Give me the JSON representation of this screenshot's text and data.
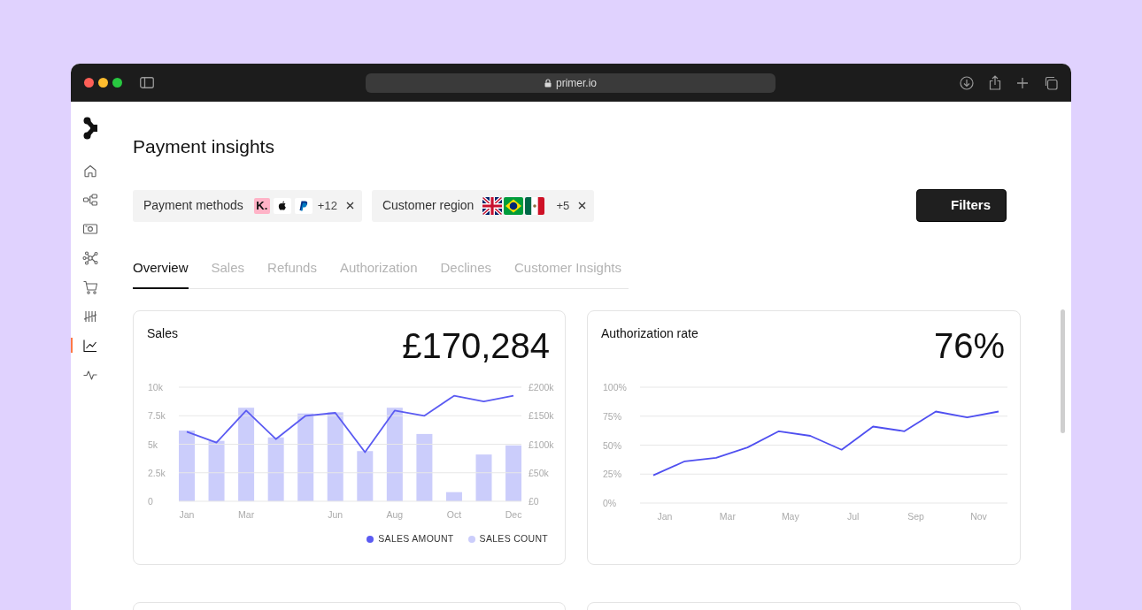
{
  "browser": {
    "url": "primer.io"
  },
  "sidebar": {
    "items": [
      {
        "kind": "home",
        "selected": false
      },
      {
        "kind": "workflow",
        "selected": false
      },
      {
        "kind": "banknote",
        "selected": false
      },
      {
        "kind": "network",
        "selected": false
      },
      {
        "kind": "cart",
        "selected": false
      },
      {
        "kind": "tally",
        "selected": false
      },
      {
        "kind": "chart",
        "selected": true
      },
      {
        "kind": "pulse",
        "selected": false
      }
    ]
  },
  "page": {
    "title": "Payment insights"
  },
  "filter_chips": [
    {
      "label": "Payment methods",
      "more": "+12",
      "logos": [
        {
          "kind": "klarna",
          "text": "K."
        },
        {
          "kind": "apple"
        },
        {
          "kind": "paypal"
        }
      ]
    },
    {
      "label": "Customer region",
      "more": "+5",
      "logos": [
        {
          "kind": "uk"
        },
        {
          "kind": "brazil"
        },
        {
          "kind": "mexico"
        }
      ]
    }
  ],
  "filters_button": "Filters",
  "tabs": [
    {
      "label": "Overview",
      "selected": true
    },
    {
      "label": "Sales",
      "selected": false
    },
    {
      "label": "Refunds",
      "selected": false
    },
    {
      "label": "Authorization",
      "selected": false
    },
    {
      "label": "Declines",
      "selected": false
    },
    {
      "label": "Customer Insights",
      "selected": false
    }
  ],
  "cards": [
    {
      "title": "Sales",
      "value": "£170,284",
      "charts": [
        {
          "chart_data": {
            "type": "line",
            "ylim": [
              0,
              200000
            ],
            "yticks": [
              {
                "value": 0,
                "label": "£0"
              },
              {
                "value": 50000,
                "label": "£50k"
              },
              {
                "value": 100000,
                "label": "£100k"
              },
              {
                "value": 150000,
                "label": "£150k"
              },
              {
                "value": 200000,
                "label": "£200k"
              }
            ],
            "series": [
              {
                "name": "SALES AMOUNT",
                "color": "#5b5bf2",
                "values": [
                  122000,
                  103000,
                  159000,
                  109000,
                  150000,
                  155000,
                  86000,
                  159000,
                  150000,
                  185000,
                  175000,
                  185000
                ]
              }
            ]
          }
        },
        {
          "chart_data": {
            "type": "bar",
            "grid": true,
            "categories": [
              "Jan",
              null,
              "Mar",
              null,
              null,
              "Jun",
              null,
              "Aug",
              null,
              "Oct",
              null,
              "Dec"
            ],
            "ylim": [
              0,
              10000
            ],
            "yticks": [
              {
                "value": 0,
                "label": "0"
              },
              {
                "value": 2500,
                "label": "2.5k"
              },
              {
                "value": 5000,
                "label": "5k"
              },
              {
                "value": 7500,
                "label": "7.5k"
              },
              {
                "value": 10000,
                "label": "10k"
              }
            ],
            "series": [
              {
                "name": "SALES COUNT",
                "color": "#cbcdfb",
                "values": [
                  6200,
                  5300,
                  8200,
                  5600,
                  7700,
                  7800,
                  4400,
                  8200,
                  5900,
                  800,
                  4100,
                  4900
                ]
              }
            ]
          }
        }
      ]
    },
    {
      "title": "Authorization rate",
      "value": "76%",
      "charts": [
        {
          "chart_data": {
            "type": "line",
            "grid": true,
            "categories": [
              "Jan",
              null,
              "Mar",
              null,
              "May",
              null,
              "Jul",
              null,
              "Sep",
              null,
              "Nov",
              null
            ],
            "ylim": [
              0,
              100
            ],
            "yticks": [
              {
                "value": 0,
                "label": "0%"
              },
              {
                "value": 25,
                "label": "25%"
              },
              {
                "value": 50,
                "label": "50%"
              },
              {
                "value": 75,
                "label": "75%"
              },
              {
                "value": 100,
                "label": "100%"
              }
            ],
            "series": [
              {
                "color": "#4f4ff0",
                "values": [
                  24,
                  36,
                  39,
                  48,
                  62,
                  58,
                  46,
                  66,
                  62,
                  79,
                  74,
                  79
                ]
              }
            ]
          }
        }
      ]
    }
  ]
}
